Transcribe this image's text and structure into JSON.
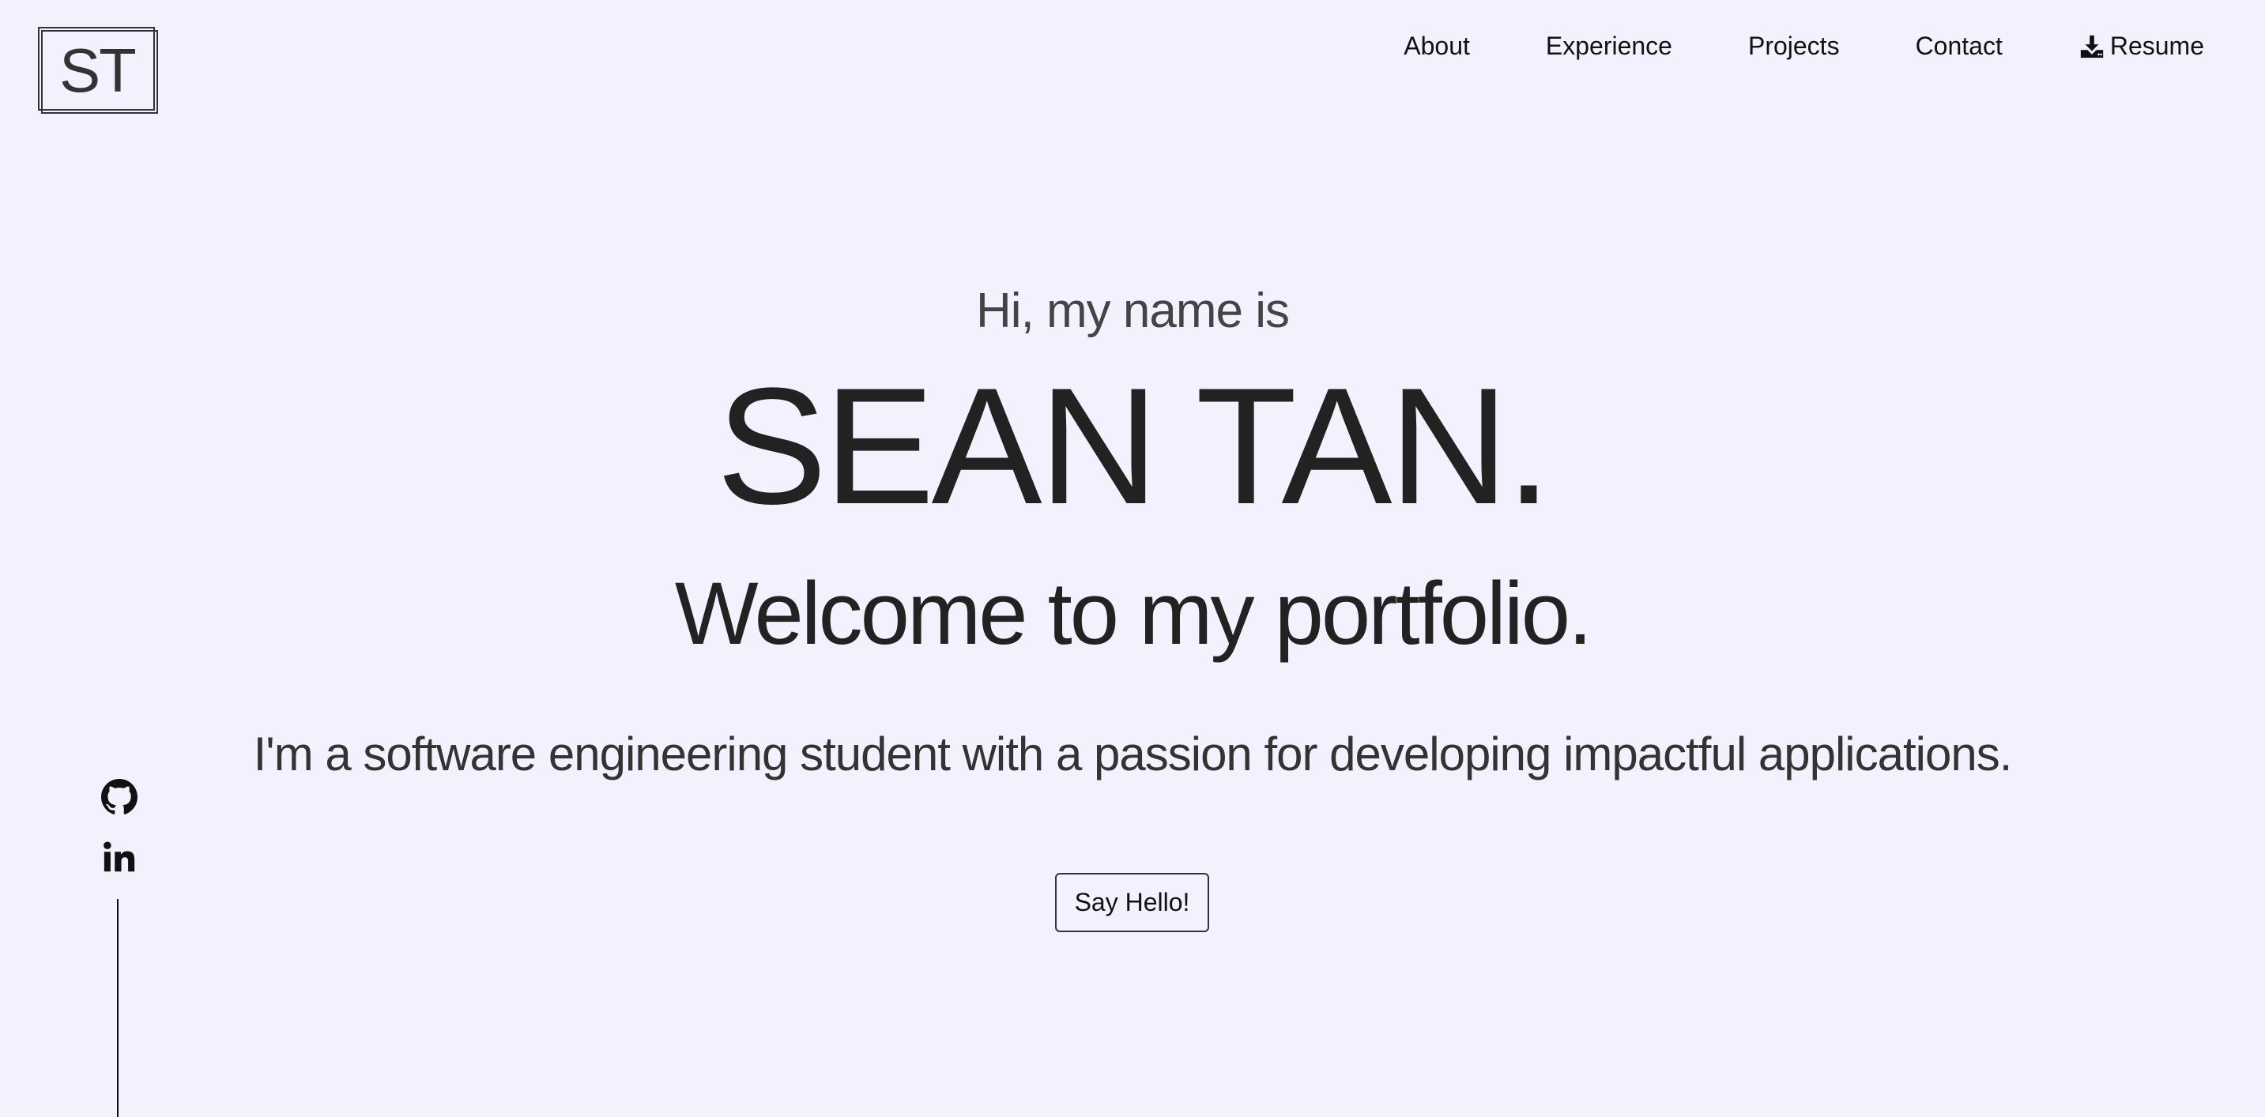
{
  "logo": {
    "text": "ST"
  },
  "nav": {
    "items": [
      {
        "label": "About"
      },
      {
        "label": "Experience"
      },
      {
        "label": "Projects"
      },
      {
        "label": "Contact"
      },
      {
        "label": "Resume",
        "icon": "download-icon"
      }
    ]
  },
  "hero": {
    "greeting": "Hi, my name is",
    "name": "SEAN TAN.",
    "welcome": "Welcome to my portfolio.",
    "tagline": "I'm a software engineering student with a passion for developing impactful applications.",
    "cta_label": "Say Hello!"
  },
  "social": {
    "icons": [
      "github-icon",
      "linkedin-icon"
    ]
  },
  "colors": {
    "background": "#f1f2fd",
    "text": "#222222"
  }
}
